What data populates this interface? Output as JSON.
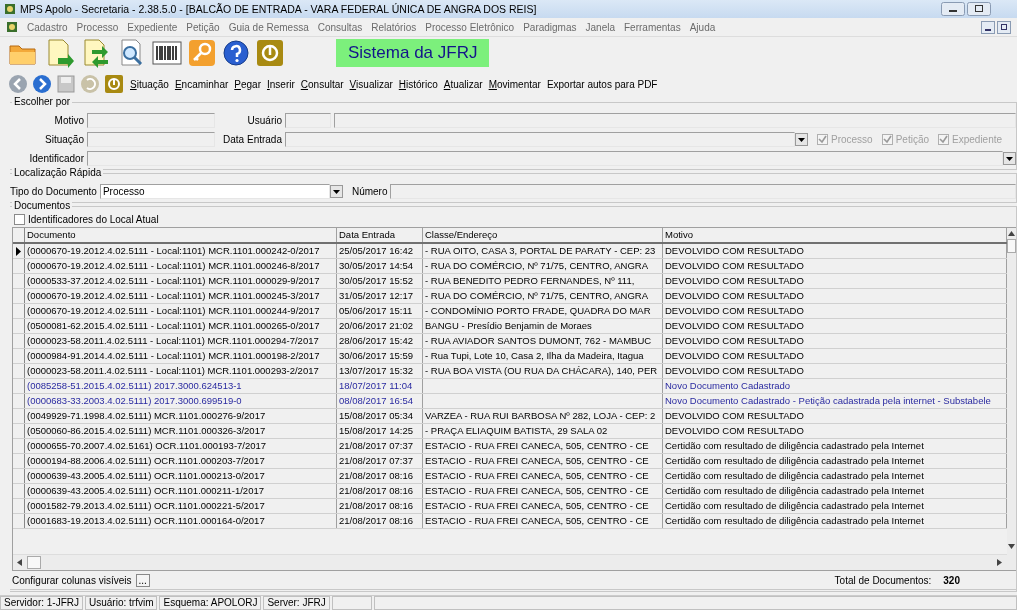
{
  "window": {
    "title": "MPS Apolo - Secretaria - 2.38.5.0 - [BALCÃO DE ENTRADA - VARA FEDERAL ÚNICA DE ANGRA DOS REIS]"
  },
  "menu": [
    "Cadastro",
    "Processo",
    "Expediente",
    "Petição",
    "Guia de Remessa",
    "Consultas",
    "Relatórios",
    "Processo Eletrônico",
    "Paradigmas",
    "Janela",
    "Ferramentas",
    "Ajuda"
  ],
  "banner": "Sistema da JFRJ",
  "actions": [
    {
      "label": "Situação",
      "mnemonic": true
    },
    {
      "label": "Encaminhar",
      "mnemonic": true
    },
    {
      "label": "Pegar",
      "mnemonic": true
    },
    {
      "label": "Inserir",
      "mnemonic": true
    },
    {
      "label": "Consultar",
      "mnemonic": true
    },
    {
      "label": "Visualizar",
      "mnemonic": true
    },
    {
      "label": "Histórico",
      "mnemonic": true
    },
    {
      "label": "Atualizar",
      "mnemonic": true
    },
    {
      "label": "Movimentar",
      "mnemonic": true
    },
    {
      "label": "Exportar autos para PDF",
      "mnemonic": false
    }
  ],
  "filter": {
    "title": "Escolher por",
    "motivo": "Motivo",
    "usuario": "Usuário",
    "situacao": "Situação",
    "data_entrada": "Data Entrada",
    "identificador": "Identificador",
    "checks": [
      {
        "label": "Processo",
        "checked": true,
        "disabled": true
      },
      {
        "label": "Petição",
        "checked": true,
        "disabled": true
      },
      {
        "label": "Expediente",
        "checked": true,
        "disabled": true
      }
    ]
  },
  "quick": {
    "title": "Localização Rápida",
    "tipo_label": "Tipo do Documento",
    "tipo_value": "Processo",
    "numero_label": "Número"
  },
  "documents": {
    "title": "Documentos",
    "local_check": {
      "label": "Identificadores do Local Atual",
      "checked": false
    },
    "columns": [
      "Documento",
      "Data Entrada",
      "Classe/Endereço",
      "Motivo"
    ],
    "rows": [
      {
        "selected": true,
        "kind": "physical",
        "doc": "(0000670-19.2012.4.02.5111 - Local:1101) MCR.1101.000242-0/2017",
        "date": "25/05/2017 16:42",
        "address": "- RUA OITO, CASA 3, PORTAL DE PARATY - CEP: 23",
        "motivo": "DEVOLVIDO COM RESULTADO"
      },
      {
        "selected": false,
        "kind": "physical",
        "doc": "(0000670-19.2012.4.02.5111 - Local:1101) MCR.1101.000246-8/2017",
        "date": "30/05/2017 14:54",
        "address": "-  RUA DO COMÉRCIO, Nº 71/75, CENTRO, ANGRA",
        "motivo": "DEVOLVIDO COM RESULTADO"
      },
      {
        "selected": false,
        "kind": "physical",
        "doc": "(0000533-37.2012.4.02.5111 - Local:1101) MCR.1101.000029-9/2017",
        "date": "30/05/2017 15:52",
        "address": "-  RUA BENEDITO PEDRO FERNANDES, Nº 111,",
        "motivo": "DEVOLVIDO COM RESULTADO"
      },
      {
        "selected": false,
        "kind": "physical",
        "doc": "(0000670-19.2012.4.02.5111 - Local:1101) MCR.1101.000245-3/2017",
        "date": "31/05/2017 12:17",
        "address": "-  RUA DO COMÉRCIO, Nº 71/75, CENTRO, ANGRA",
        "motivo": "DEVOLVIDO COM RESULTADO"
      },
      {
        "selected": false,
        "kind": "physical",
        "doc": "(0000670-19.2012.4.02.5111 - Local:1101) MCR.1101.000244-9/2017",
        "date": "05/06/2017 15:11",
        "address": "-  CONDOMÍNIO PORTO FRADE, QUADRA DO MAR",
        "motivo": "DEVOLVIDO COM RESULTADO"
      },
      {
        "selected": false,
        "kind": "physical",
        "doc": "(0500081-62.2015.4.02.5111 - Local:1101) MCR.1101.000265-0/2017",
        "date": "20/06/2017 21:02",
        "address": "BANGU -  Presídio Benjamin de Moraes",
        "motivo": "DEVOLVIDO COM RESULTADO"
      },
      {
        "selected": false,
        "kind": "physical",
        "doc": "(0000023-58.2011.4.02.5111 - Local:1101) MCR.1101.000294-7/2017",
        "date": "28/06/2017 15:42",
        "address": "-  RUA AVIADOR SANTOS DUMONT, 762 - MAMBUC",
        "motivo": "DEVOLVIDO COM RESULTADO"
      },
      {
        "selected": false,
        "kind": "physical",
        "doc": "(0000984-91.2014.4.02.5111 - Local:1101) MCR.1101.000198-2/2017",
        "date": "30/06/2017 15:59",
        "address": "-  Rua Tupi, Lote 10, Casa 2, Ilha da Madeira, Itagua",
        "motivo": "DEVOLVIDO COM RESULTADO"
      },
      {
        "selected": false,
        "kind": "physical",
        "doc": "(0000023-58.2011.4.02.5111 - Local:1101) MCR.1101.000293-2/2017",
        "date": "13/07/2017 15:32",
        "address": "- RUA BOA VISTA (OU RUA DA CHÁCARA), 140, PER",
        "motivo": "DEVOLVIDO COM RESULTADO"
      },
      {
        "selected": false,
        "kind": "electronic",
        "doc": "(0085258-51.2015.4.02.5111) 2017.3000.624513-1",
        "date": "18/07/2017 11:04",
        "motivo": "Novo Documento Cadastrado"
      },
      {
        "selected": false,
        "kind": "electronic",
        "doc": "(0000683-33.2003.4.02.5111) 2017.3000.699519-0",
        "date": "08/08/2017 16:54",
        "motivo": "Novo Documento Cadastrado - Petição cadastrada pela internet - Substabele"
      },
      {
        "selected": false,
        "kind": "physical",
        "doc": "(0049929-71.1998.4.02.5111) MCR.1101.000276-9/2017",
        "date": "15/08/2017 05:34",
        "address": "VARZEA - RUA RUI BARBOSA Nº 282, LOJA - CEP: 2",
        "motivo": "DEVOLVIDO COM RESULTADO"
      },
      {
        "selected": false,
        "kind": "physical",
        "doc": "(0500060-86.2015.4.02.5111) MCR.1101.000326-3/2017",
        "date": "15/08/2017 14:25",
        "address": " - PRAÇA ELIAQUIM BATISTA, 29 SALA 02",
        "motivo": "DEVOLVIDO COM RESULTADO"
      },
      {
        "selected": false,
        "kind": "physical",
        "doc": "(0000655-70.2007.4.02.5161) OCR.1101.000193-7/2017",
        "date": "21/08/2017 07:37",
        "address": "ESTACIO - RUA FREI CANECA, 505, CENTRO - CE",
        "motivo": "Certidão com resultado de diligência cadastrado pela Internet"
      },
      {
        "selected": false,
        "kind": "physical",
        "doc": "(0000194-88.2006.4.02.5111) OCR.1101.000203-7/2017",
        "date": "21/08/2017 07:37",
        "address": "ESTACIO - RUA FREI CANECA, 505, CENTRO - CE",
        "motivo": "Certidão com resultado de diligência cadastrado pela Internet"
      },
      {
        "selected": false,
        "kind": "physical",
        "doc": "(0000639-43.2005.4.02.5111) OCR.1101.000213-0/2017",
        "date": "21/08/2017 08:16",
        "address": "ESTACIO - RUA FREI CANECA, 505, CENTRO - CE",
        "motivo": "Certidão com resultado de diligência cadastrado pela Internet"
      },
      {
        "selected": false,
        "kind": "physical",
        "doc": "(0000639-43.2005.4.02.5111) OCR.1101.000211-1/2017",
        "date": "21/08/2017 08:16",
        "address": "ESTACIO - RUA FREI CANECA, 505, CENTRO - CE",
        "motivo": "Certidão com resultado de diligência cadastrado pela Internet"
      },
      {
        "selected": false,
        "kind": "physical",
        "doc": "(0001582-79.2013.4.02.5111) OCR.1101.000221-5/2017",
        "date": "21/08/2017 08:16",
        "address": "ESTACIO - RUA FREI CANECA, 505, CENTRO - CE",
        "motivo": "Certidão com resultado de diligência cadastrado pela Internet"
      },
      {
        "selected": false,
        "kind": "physical",
        "doc": "(0001683-19.2013.4.02.5111) OCR.1101.000164-0/2017",
        "date": "21/08/2017 08:16",
        "address": "ESTACIO - RUA FREI CANECA, 505, CENTRO - CE",
        "motivo": "Certidão com resultado de diligência cadastrado pela Internet"
      }
    ],
    "configure": "Configurar colunas visíveis",
    "configure_button": "...",
    "total_label": "Total de Documentos:",
    "total": "320"
  },
  "status_bar": [
    "Servidor: 1-JFRJ",
    "Usuário: trfvim",
    "Esquema: APOLORJ",
    "Server: JFRJ"
  ]
}
